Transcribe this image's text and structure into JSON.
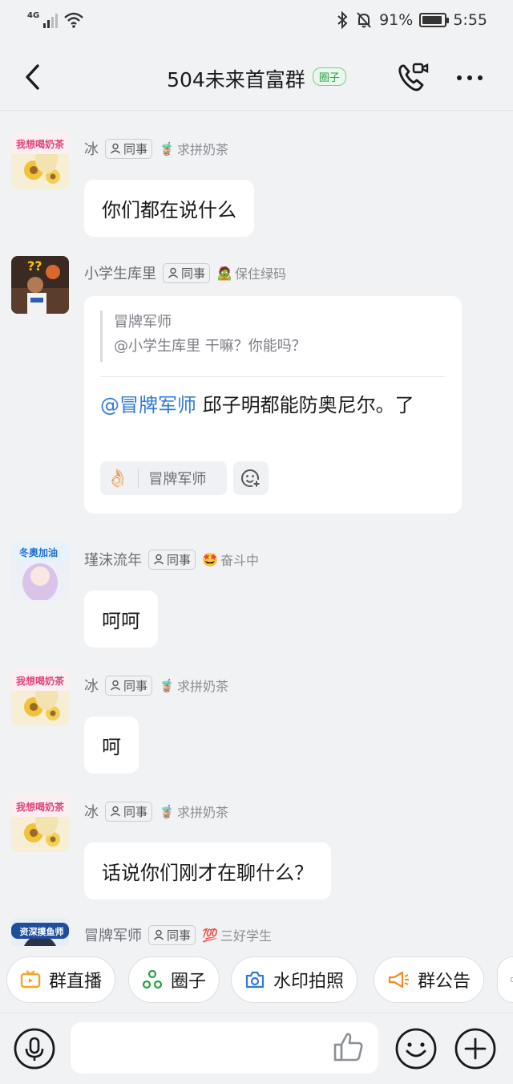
{
  "status_bar": {
    "network": "4G",
    "battery_percent": "91%",
    "battery_level": 0.91,
    "time": "5:55"
  },
  "header": {
    "title": "504未来首富群",
    "tag": "圈子"
  },
  "messages": [
    {
      "sender": "冰",
      "role": "同事",
      "status_emoji": "🧋",
      "status_text": "求拼奶茶",
      "text": "你们都在说什么",
      "avatar_caption": "我想喝奶茶"
    },
    {
      "sender": "小学生库里",
      "role": "同事",
      "status_emoji": "🧟",
      "status_text": "保住绿码",
      "reply": {
        "quoted_name": "冒牌军师",
        "quoted_text": "@小学生库里 干嘛？你能吗？",
        "mention": "@冒牌军师",
        "body": " 邱子明都能防奥尼尔。了",
        "reaction_emoji": "👌🏻",
        "reaction_user": "冒牌军师"
      }
    },
    {
      "sender": "瑾沫流年",
      "role": "同事",
      "status_emoji": "🤩",
      "status_text": "奋斗中",
      "text": "呵呵",
      "avatar_caption": "冬奥加油"
    },
    {
      "sender": "冰",
      "role": "同事",
      "status_emoji": "🧋",
      "status_text": "求拼奶茶",
      "text": "呵",
      "avatar_caption": "我想喝奶茶"
    },
    {
      "sender": "冰",
      "role": "同事",
      "status_emoji": "🧋",
      "status_text": "求拼奶茶",
      "text": "话说你们刚才在聊什么？",
      "avatar_caption": "我想喝奶茶"
    },
    {
      "sender": "冒牌军师",
      "role": "同事",
      "status_emoji": "💯",
      "status_text": "三好学生",
      "avatar_caption": "资深摸鱼师"
    }
  ],
  "quick_actions": [
    {
      "label": "群直播",
      "icon": "tv-icon",
      "color": "#f5a623"
    },
    {
      "label": "圈子",
      "icon": "circle-nodes-icon",
      "color": "#2ba245"
    },
    {
      "label": "水印拍照",
      "icon": "camera-icon",
      "color": "#2f7bd8"
    },
    {
      "label": "群公告",
      "icon": "megaphone-icon",
      "color": "#f28b22"
    }
  ],
  "input": {
    "placeholder": ""
  }
}
